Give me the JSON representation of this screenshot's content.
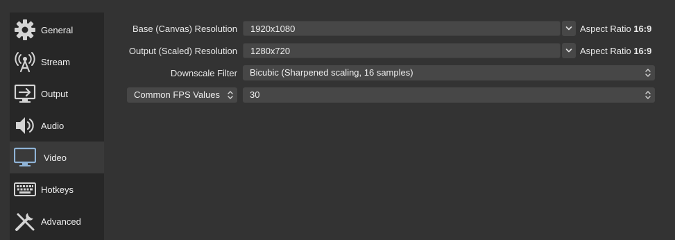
{
  "sidebar": {
    "items": [
      {
        "label": "General",
        "icon": "gear-icon"
      },
      {
        "label": "Stream",
        "icon": "broadcast-antenna-icon"
      },
      {
        "label": "Output",
        "icon": "output-monitor-icon"
      },
      {
        "label": "Audio",
        "icon": "speaker-icon"
      },
      {
        "label": "Video",
        "icon": "monitor-icon",
        "active": true
      },
      {
        "label": "Hotkeys",
        "icon": "keyboard-icon"
      },
      {
        "label": "Advanced",
        "icon": "tools-icon"
      }
    ]
  },
  "video": {
    "base_resolution": {
      "label": "Base (Canvas) Resolution",
      "value": "1920x1080",
      "aspect_prefix": "Aspect Ratio",
      "aspect_value": "16:9"
    },
    "output_resolution": {
      "label": "Output (Scaled) Resolution",
      "value": "1280x720",
      "aspect_prefix": "Aspect Ratio",
      "aspect_value": "16:9"
    },
    "downscale_filter": {
      "label": "Downscale Filter",
      "value": "Bicubic (Sharpened scaling, 16 samples)"
    },
    "fps": {
      "type_label": "Common FPS Values",
      "value": "30"
    }
  },
  "colors": {
    "background": "#333333",
    "sidebar": "#272727",
    "sidebar_active": "#3a3a3a",
    "field": "#474747",
    "text": "#e8e8e8"
  }
}
